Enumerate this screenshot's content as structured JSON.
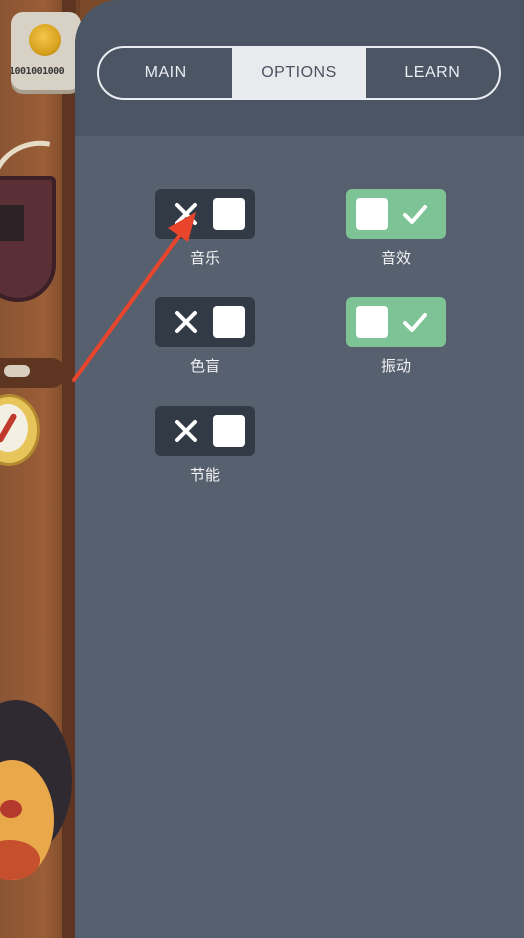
{
  "game": {
    "coin_counter": "1001001000"
  },
  "tabs": [
    {
      "label": "MAIN",
      "active": false
    },
    {
      "label": "OPTIONS",
      "active": true
    },
    {
      "label": "LEARN",
      "active": false
    }
  ],
  "options": {
    "music": {
      "label": "音乐",
      "enabled": false
    },
    "sound_effects": {
      "label": "音效",
      "enabled": true
    },
    "colorblind": {
      "label": "色盲",
      "enabled": false
    },
    "vibration": {
      "label": "振动",
      "enabled": true
    },
    "power_saving": {
      "label": "节能",
      "enabled": false
    }
  },
  "colors": {
    "panel": "#56606e",
    "toggle_off": "#323a46",
    "toggle_on": "#7ec396",
    "annotation_arrow": "#e8452c"
  },
  "icons": {
    "off_symbol": "x-icon",
    "on_symbol": "check-icon"
  }
}
